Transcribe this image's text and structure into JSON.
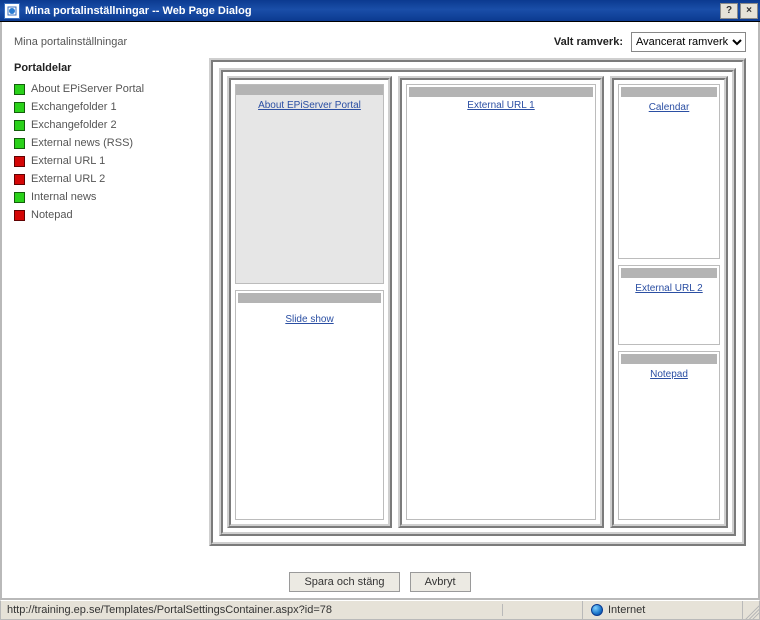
{
  "titlebar": {
    "app_icon": "ie-page-icon",
    "text": "Mina portalinställningar -- Web Page Dialog",
    "help": "?",
    "close": "×"
  },
  "header": {
    "page_title": "Mina portalinställningar",
    "framework_label": "Valt ramverk:",
    "framework_selected": "Avancerat ramverk"
  },
  "sidebar": {
    "heading": "Portaldelar",
    "items": [
      {
        "label": "About EPiServer Portal",
        "color": "green"
      },
      {
        "label": "Exchangefolder 1",
        "color": "green"
      },
      {
        "label": "Exchangefolder 2",
        "color": "green"
      },
      {
        "label": "External news (RSS)",
        "color": "green"
      },
      {
        "label": "External URL 1",
        "color": "red"
      },
      {
        "label": "External URL 2",
        "color": "red"
      },
      {
        "label": "Internal news",
        "color": "green"
      },
      {
        "label": "Notepad",
        "color": "red"
      }
    ]
  },
  "layout": {
    "col1": {
      "portlet_a": "About EPiServer Portal",
      "portlet_b": "Slide show"
    },
    "col2": {
      "portlet_c": "External URL 1"
    },
    "col3": {
      "portlet_d": "Calendar",
      "portlet_e": "External URL 2",
      "portlet_f": "Notepad"
    }
  },
  "buttons": {
    "save": "Spara och stäng",
    "cancel": "Avbryt"
  },
  "statusbar": {
    "url": "http://training.ep.se/Templates/PortalSettingsContainer.aspx?id=78",
    "zone": "Internet"
  }
}
